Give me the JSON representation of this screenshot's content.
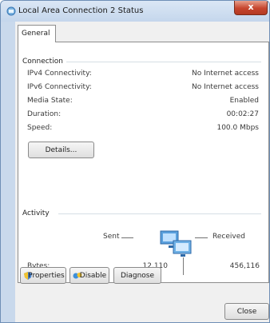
{
  "window": {
    "title": "Local Area Connection 2 Status",
    "close_glyph": "x"
  },
  "tabs": [
    {
      "label": "General"
    }
  ],
  "connection": {
    "group_label": "Connection",
    "rows": [
      {
        "label": "IPv4 Connectivity:",
        "value": "No Internet access"
      },
      {
        "label": "IPv6 Connectivity:",
        "value": "No Internet access"
      },
      {
        "label": "Media State:",
        "value": "Enabled"
      },
      {
        "label": "Duration:",
        "value": "00:02:27"
      },
      {
        "label": "Speed:",
        "value": "100.0 Mbps"
      }
    ],
    "details_label": "Details..."
  },
  "activity": {
    "group_label": "Activity",
    "sent_label": "Sent",
    "received_label": "Received",
    "bytes_label": "Bytes:",
    "sent_value": "12,110",
    "received_value": "456,116"
  },
  "actions": {
    "properties_label": "Properties",
    "disable_label": "Disable",
    "diagnose_label": "Diagnose",
    "close_label": "Close"
  },
  "icons": {
    "window_icon": "network-adapter-icon",
    "activity_icon": "network-computers-icon",
    "properties_icon": "shield-icon",
    "disable_icon": "network-disable-icon"
  }
}
